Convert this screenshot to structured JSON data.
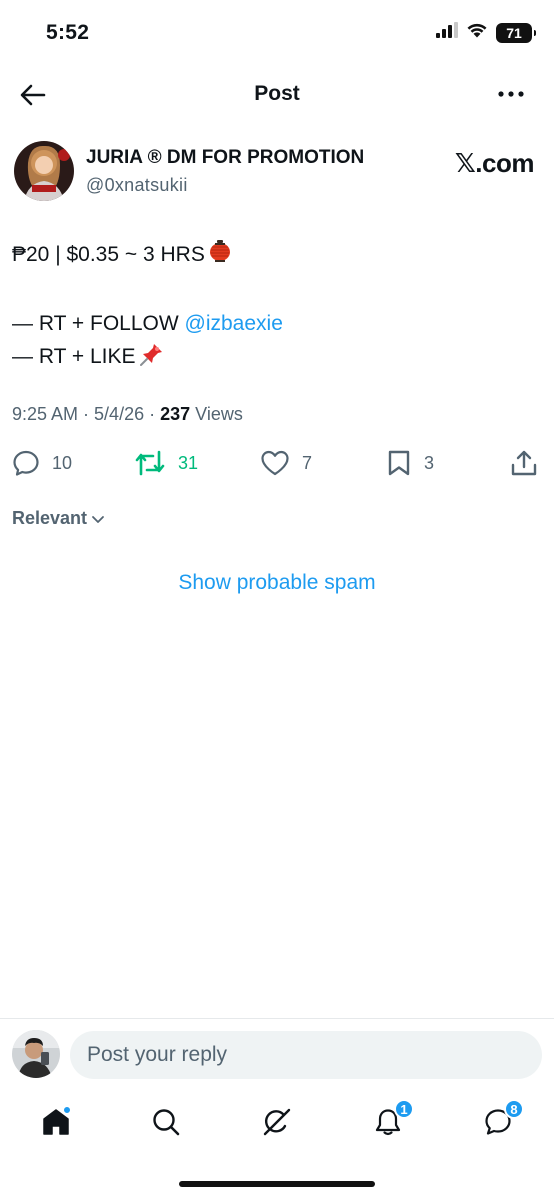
{
  "status_bar": {
    "time": "5:52",
    "battery": "71"
  },
  "header": {
    "title": "Post"
  },
  "author": {
    "name": "JURIA ® DM FOR PROMOTION",
    "handle": "@0xnatsukii",
    "source": "𝕏.com"
  },
  "post": {
    "line1": "₱20 | $0.35 ~ 3 HRS",
    "line1_emoji": "lantern-emoji",
    "line2_prefix": "— RT + FOLLOW ",
    "line2_mention": "@izbaexie",
    "line3": "— RT + LIKE",
    "line3_emoji": "pushpin-emoji"
  },
  "meta": {
    "time": "9:25 AM",
    "sep1": " · ",
    "date": "5/4/26",
    "sep2": " · ",
    "views_count": "237",
    "views_label": " Views"
  },
  "actions": {
    "replies": "10",
    "reposts": "31",
    "likes": "7",
    "bookmarks": "3"
  },
  "sort": {
    "label": "Relevant"
  },
  "spam": {
    "label": "Show probable spam"
  },
  "reply": {
    "placeholder": "Post your reply"
  },
  "tabs": {
    "notifications_badge": "1",
    "messages_badge": "8"
  },
  "colors": {
    "accent": "#1d9bf0",
    "repost": "#00ba7c",
    "secondary_text": "#536471",
    "primary_text": "#0f1419"
  }
}
